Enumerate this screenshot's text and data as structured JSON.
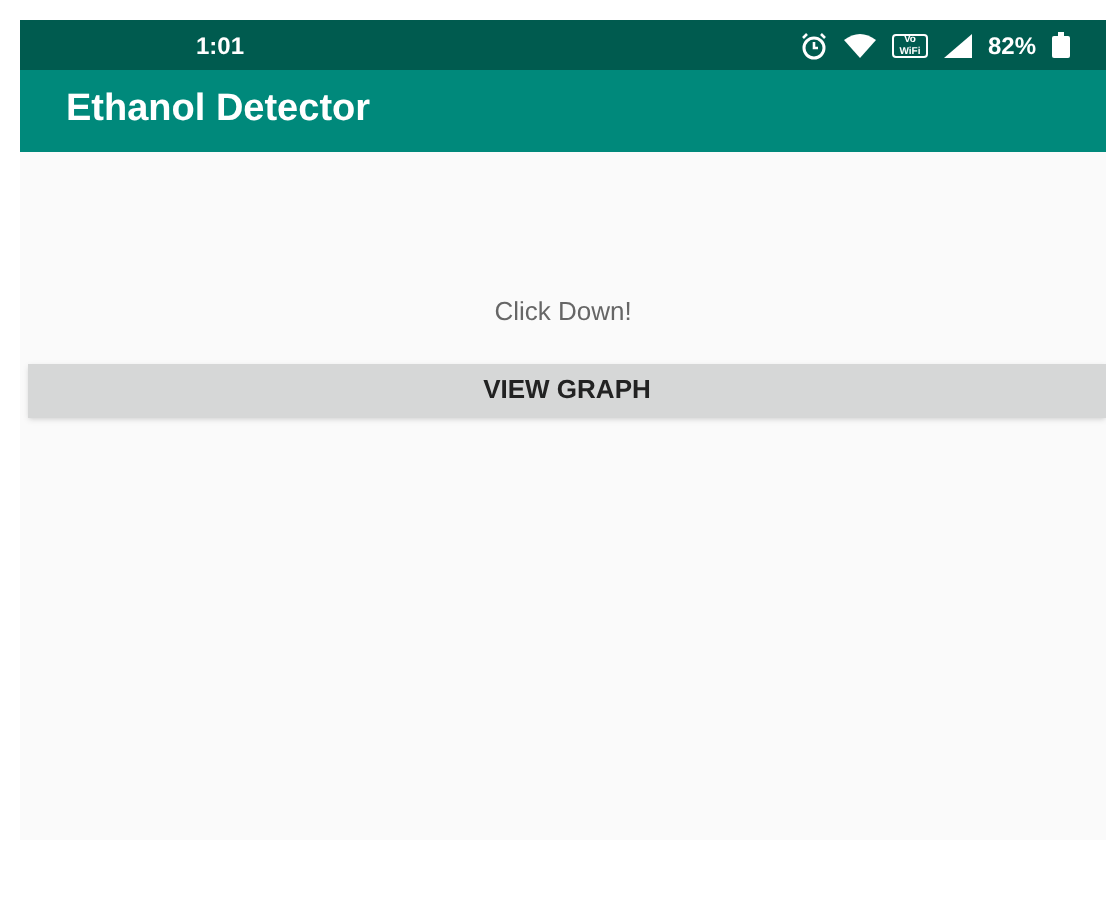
{
  "status_bar": {
    "time": "1:01",
    "volte": "Vo WiFi",
    "battery": "82%"
  },
  "app_bar": {
    "title": "Ethanol Detector"
  },
  "content": {
    "message": "Click Down!",
    "button": "VIEW GRAPH"
  }
}
